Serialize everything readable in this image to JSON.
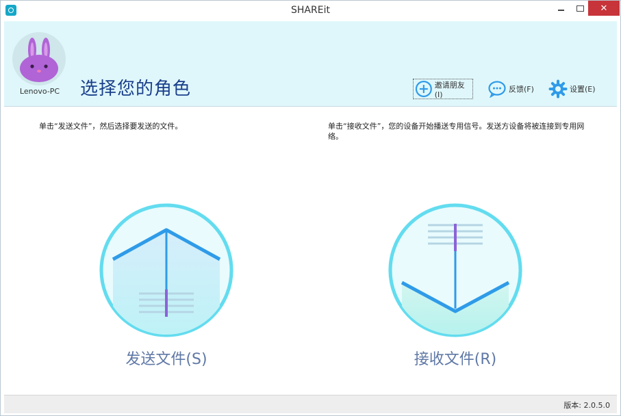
{
  "window": {
    "title": "SHAREit",
    "close_glyph": "✕"
  },
  "header": {
    "device_name": "Lenovo-PC",
    "page_title": "选择您的角色",
    "toolbar": {
      "invite_label": "邀请朋友(I)",
      "feedback_label": "反馈(F)",
      "settings_label": "设置(E)"
    }
  },
  "main": {
    "send": {
      "description": "单击“发送文件”，然后选择要发送的文件。",
      "label": "发送文件(S)"
    },
    "receive": {
      "description": "单击“接收文件”，您的设备开始播送专用信号。发送方设备将被连接到专用网络。",
      "label": "接收文件(R)"
    }
  },
  "statusbar": {
    "version": "版本: 2.0.5.0"
  },
  "colors": {
    "header_bg": "#dff7fb",
    "accent_blue": "#2f9be8",
    "circle_ring": "#63dcef",
    "title_blue": "#1a3f8a",
    "label_blue": "#5f78a6",
    "close_red": "#c7343a",
    "purple_line": "#8c63d9"
  }
}
